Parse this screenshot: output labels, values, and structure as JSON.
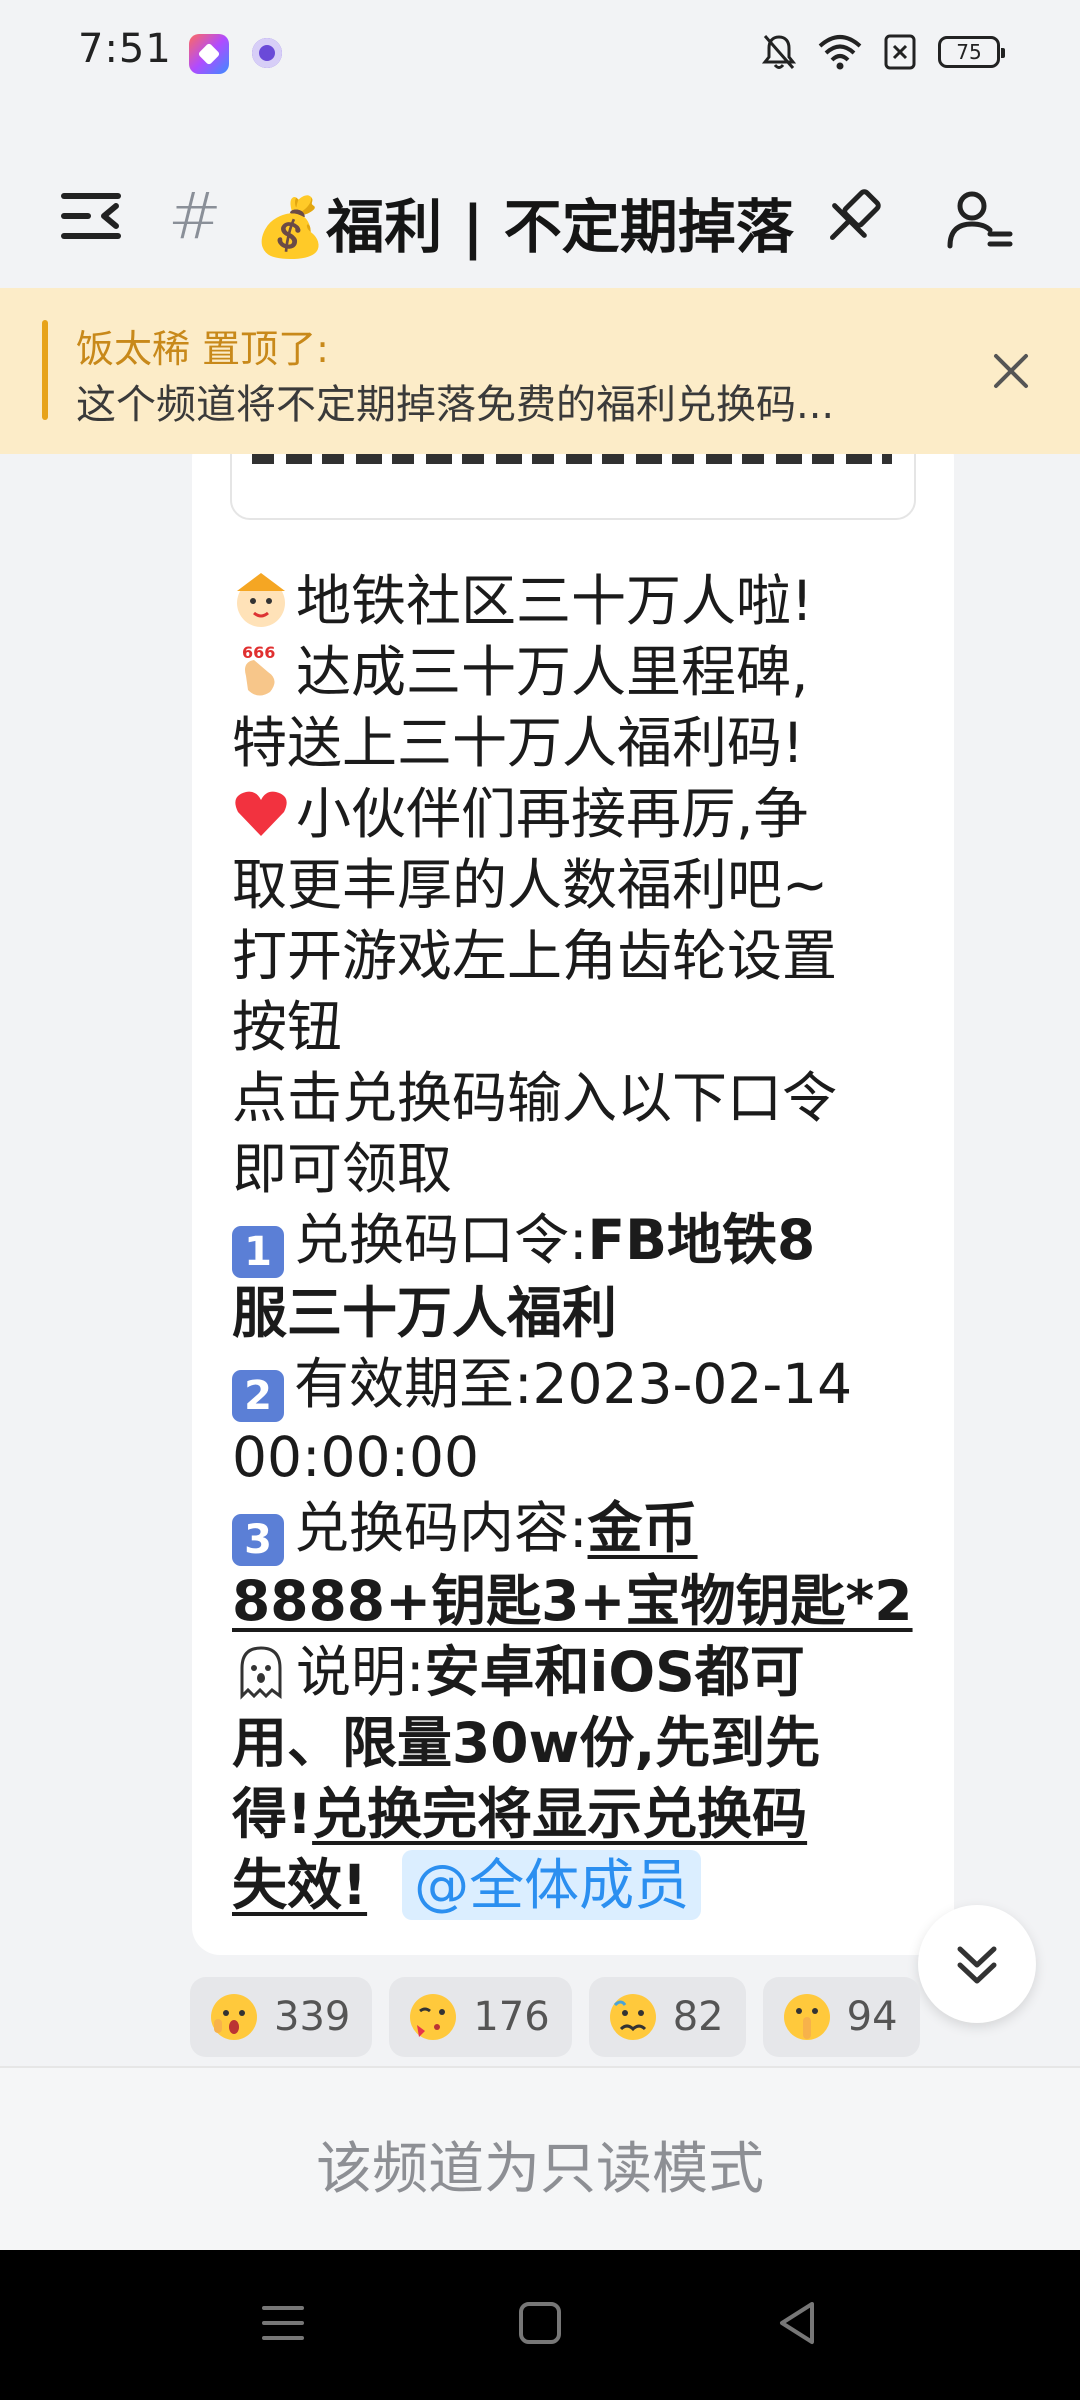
{
  "status_bar": {
    "time": "7:51",
    "battery": "75"
  },
  "header": {
    "hash": "#",
    "title": "💰福利 | 不定期掉落"
  },
  "pinned": {
    "author_line": "饭太稀 置顶了:",
    "text": "这个频道将不定期掉落免费的福利兑换码..."
  },
  "message": {
    "line1": "地铁社区三十万人啦!",
    "line2": "达成三十万人里程碑,",
    "line3": "特送上三十万人福利码!",
    "line4a": "小伙伴们再接再厉,争",
    "line4b": "取更丰厚的人数福利吧~",
    "line5a": "打开游戏左上角齿轮设置",
    "line5b": "按钮",
    "line6a": "点击兑换码输入以下口令",
    "line6b": "即可领取",
    "n1": "1",
    "item1_label": "兑换码口令:",
    "item1_value_a": "FB地铁8",
    "item1_value_b": "服三十万人福利",
    "n2": "2",
    "item2_label": "有效期至:",
    "item2_value_a": "2023-02-14",
    "item2_value_b": "00:00:00",
    "n3": "3",
    "item3_label": "兑换码内容:",
    "item3_value_a": "金币",
    "item3_value_b": "8888+钥匙3+宝物钥匙*2",
    "note_label": "说明:",
    "note_bold_a": "安卓和iOS都可",
    "note_bold_b": "用、限量30w份,先到先",
    "note_bold_c": "得!",
    "note_underline_a": "兑换完将显示兑换码",
    "note_underline_b": "失效!",
    "mention": "@全体成员"
  },
  "reactions": [
    {
      "count": "339",
      "icon": "shocked-face-icon"
    },
    {
      "count": "176",
      "icon": "kissing-face-icon"
    },
    {
      "count": "82",
      "icon": "nauseated-face-icon"
    },
    {
      "count": "94",
      "icon": "shushing-face-icon"
    }
  ],
  "footer": {
    "readonly_text": "该频道为只读模式"
  },
  "colors": {
    "pinned_bg": "#fcecc8",
    "pinned_accent": "#e7a31a",
    "mention": "#2b8ff0",
    "number_box": "#5b7fd6"
  }
}
